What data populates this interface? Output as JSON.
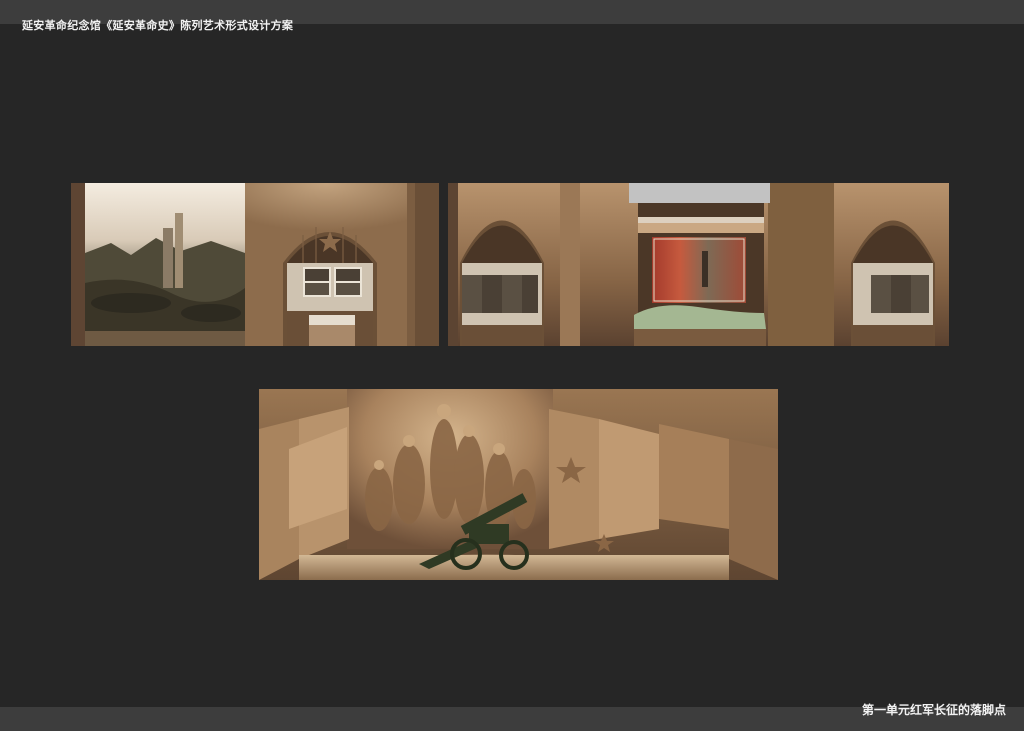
{
  "header": {
    "title": "延安革命纪念馆《延安革命史》陈列艺术形式设计方案"
  },
  "footer": {
    "caption": "第一单元红军长征的落脚点"
  },
  "colors": {
    "background": "#262626",
    "bar": "#3d3d3d",
    "text": "#f2f2f2",
    "wall": "#8a6a4a"
  }
}
